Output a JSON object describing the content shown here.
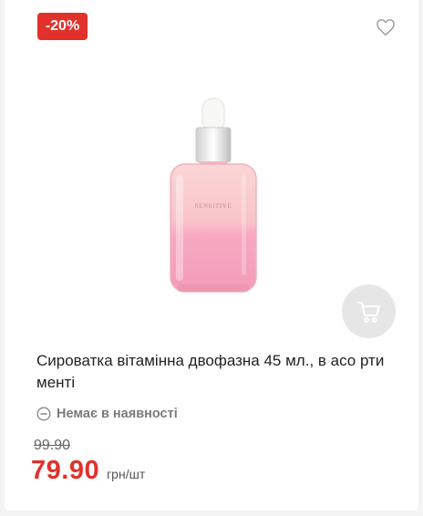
{
  "product": {
    "discount_badge": "-20%",
    "title": "Сироватка вітамінна двофазна 45 мл., в асо ртименті",
    "availability": "Немає в наявності",
    "old_price": "99.90",
    "price": "79.90",
    "unit": "грн/шт",
    "image_label": "SENSITIVE"
  },
  "icons": {
    "favorite": "heart-outline-icon",
    "cart": "cart-icon",
    "availability": "minus-circle-icon"
  },
  "colors": {
    "accent": "#e2312b",
    "muted": "#7a7a7a",
    "cart_bg": "#e6e6e6"
  }
}
